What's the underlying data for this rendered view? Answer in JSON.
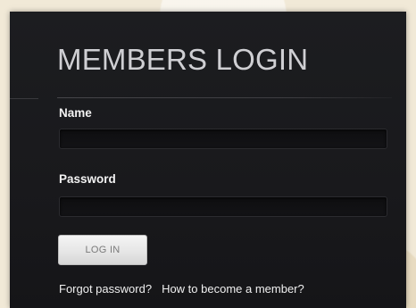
{
  "login": {
    "title": "MEMBERS LOGIN",
    "name_label": "Name",
    "name_value": "",
    "password_label": "Password",
    "password_value": "",
    "login_button": "LOG IN",
    "forgot_password_link": "Forgot password?",
    "become_member_link": "How to become a member?"
  },
  "colors": {
    "panel_background": "#1b1c1f",
    "outer_background": "#f1e9d7",
    "title_text": "#cfcfd3",
    "label_text": "#f2f2f2",
    "button_background": "#e6e6e6",
    "button_text": "#7a7a7a"
  }
}
